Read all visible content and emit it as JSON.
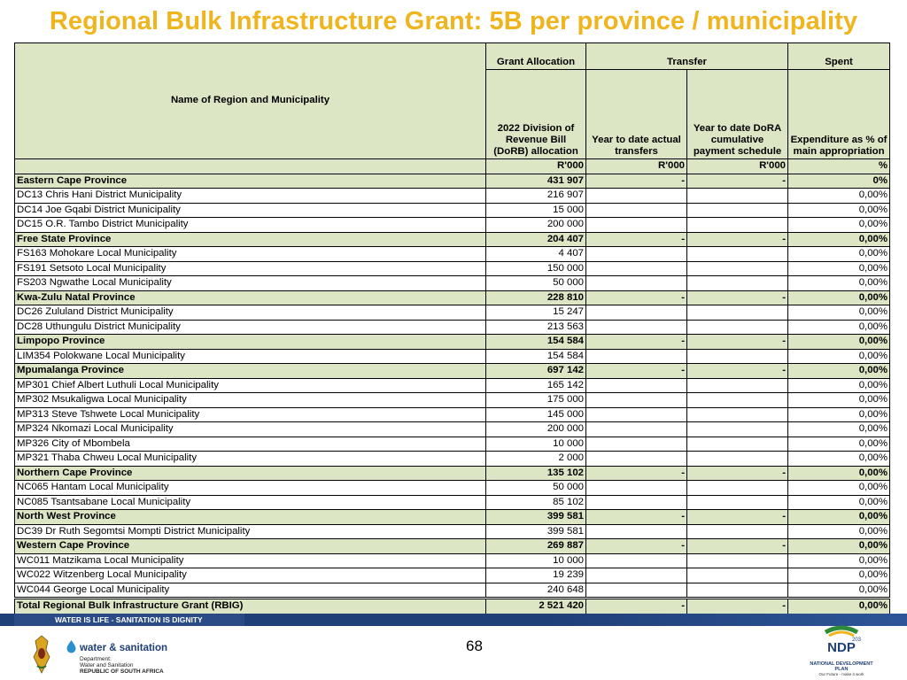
{
  "title": "Regional Bulk Infrastructure Grant: 5B per province / municipality",
  "table": {
    "name_header": "Name of Region and Municipality",
    "group_headers": {
      "grant_allocation": "Grant Allocation",
      "transfer": "Transfer",
      "spent": "Spent"
    },
    "col_headers": {
      "allocation": "2022 Division of Revenue Bill (DoRB) allocation",
      "ytd_actual": "Year to date actual transfers",
      "ytd_dora": "Year to date DoRA cumulative payment schedule",
      "expenditure": "Expenditure as % of main appropriation"
    },
    "units": {
      "allocation": "R'000",
      "ytd_actual": "R'000",
      "ytd_dora": "R'000",
      "expenditure": "%"
    },
    "rows": [
      {
        "type": "province",
        "name": "Eastern Cape Province",
        "allocation": "431 907",
        "ytd_actual": "-",
        "ytd_dora": "-",
        "expenditure": "0%"
      },
      {
        "type": "municipality",
        "name": "DC13 Chris Hani District Municipality",
        "allocation": "216 907",
        "ytd_actual": "",
        "ytd_dora": "",
        "expenditure": "0,00%"
      },
      {
        "type": "municipality",
        "name": "DC14 Joe Gqabi District Municipality",
        "allocation": "15 000",
        "ytd_actual": "",
        "ytd_dora": "",
        "expenditure": "0,00%"
      },
      {
        "type": "municipality",
        "name": "DC15 O.R. Tambo District Municipality",
        "allocation": "200 000",
        "ytd_actual": "",
        "ytd_dora": "",
        "expenditure": "0,00%"
      },
      {
        "type": "province",
        "name": "Free State Province",
        "allocation": "204 407",
        "ytd_actual": "-",
        "ytd_dora": "-",
        "expenditure": "0,00%"
      },
      {
        "type": "municipality",
        "name": "FS163 Mohokare Local Municipality",
        "allocation": "4 407",
        "ytd_actual": "",
        "ytd_dora": "",
        "expenditure": "0,00%"
      },
      {
        "type": "municipality",
        "name": "FS191 Setsoto Local Municipality",
        "allocation": "150 000",
        "ytd_actual": "",
        "ytd_dora": "",
        "expenditure": "0,00%"
      },
      {
        "type": "municipality",
        "name": "FS203 Ngwathe Local Municipality",
        "allocation": "50 000",
        "ytd_actual": "",
        "ytd_dora": "",
        "expenditure": "0,00%"
      },
      {
        "type": "province",
        "name": "Kwa-Zulu Natal Province",
        "allocation": "228 810",
        "ytd_actual": "-",
        "ytd_dora": "-",
        "expenditure": "0,00%"
      },
      {
        "type": "municipality",
        "name": "DC26 Zululand District Municipality",
        "allocation": "15 247",
        "ytd_actual": "",
        "ytd_dora": "",
        "expenditure": "0,00%"
      },
      {
        "type": "municipality",
        "name": "DC28 Uthungulu District Municipality",
        "allocation": "213 563",
        "ytd_actual": "",
        "ytd_dora": "",
        "expenditure": "0,00%"
      },
      {
        "type": "province",
        "name": "Limpopo Province",
        "allocation": "154 584",
        "ytd_actual": "-",
        "ytd_dora": "-",
        "expenditure": "0,00%"
      },
      {
        "type": "municipality",
        "name": "LIM354 Polokwane Local Municipality",
        "allocation": "154 584",
        "ytd_actual": "",
        "ytd_dora": "",
        "expenditure": "0,00%"
      },
      {
        "type": "province",
        "name": "Mpumalanga Province",
        "allocation": "697 142",
        "ytd_actual": "-",
        "ytd_dora": "-",
        "expenditure": "0,00%"
      },
      {
        "type": "municipality",
        "name": "MP301 Chief Albert Luthuli Local Municipality",
        "allocation": "165 142",
        "ytd_actual": "",
        "ytd_dora": "",
        "expenditure": "0,00%"
      },
      {
        "type": "municipality",
        "name": "MP302 Msukaligwa Local Municipality",
        "allocation": "175 000",
        "ytd_actual": "",
        "ytd_dora": "",
        "expenditure": "0,00%"
      },
      {
        "type": "municipality",
        "name": "MP313 Steve Tshwete Local Municipality",
        "allocation": "145 000",
        "ytd_actual": "",
        "ytd_dora": "",
        "expenditure": "0,00%"
      },
      {
        "type": "municipality",
        "name": "MP324 Nkomazi Local Municipality",
        "allocation": "200 000",
        "ytd_actual": "",
        "ytd_dora": "",
        "expenditure": "0,00%"
      },
      {
        "type": "municipality",
        "name": "MP326 City of Mbombela",
        "allocation": "10 000",
        "ytd_actual": "",
        "ytd_dora": "",
        "expenditure": "0,00%"
      },
      {
        "type": "municipality",
        "name": "MP321 Thaba Chweu Local Municipality",
        "allocation": "2 000",
        "ytd_actual": "",
        "ytd_dora": "",
        "expenditure": "0,00%"
      },
      {
        "type": "province",
        "name": "Northern Cape Province",
        "allocation": "135 102",
        "ytd_actual": "-",
        "ytd_dora": "-",
        "expenditure": "0,00%"
      },
      {
        "type": "municipality",
        "name": "NC065 Hantam Local Municipality",
        "allocation": "50 000",
        "ytd_actual": "",
        "ytd_dora": "",
        "expenditure": "0,00%"
      },
      {
        "type": "municipality",
        "name": "NC085 Tsantsabane Local Municipality",
        "allocation": "85 102",
        "ytd_actual": "",
        "ytd_dora": "",
        "expenditure": "0,00%"
      },
      {
        "type": "province",
        "name": "North West Province",
        "allocation": "399 581",
        "ytd_actual": "-",
        "ytd_dora": "-",
        "expenditure": "0,00%"
      },
      {
        "type": "municipality",
        "name": "DC39 Dr Ruth Segomtsi Mompti District Municipality",
        "allocation": "399 581",
        "ytd_actual": "",
        "ytd_dora": "",
        "expenditure": "0,00%"
      },
      {
        "type": "province",
        "name": "Western Cape Province",
        "allocation": "269 887",
        "ytd_actual": "-",
        "ytd_dora": "-",
        "expenditure": "0,00%"
      },
      {
        "type": "municipality",
        "name": "WC011 Matzikama Local Municipality",
        "allocation": "10 000",
        "ytd_actual": "",
        "ytd_dora": "",
        "expenditure": "0,00%"
      },
      {
        "type": "municipality",
        "name": "WC022 Witzenberg Local Municipality",
        "allocation": "19 239",
        "ytd_actual": "",
        "ytd_dora": "",
        "expenditure": "0,00%"
      },
      {
        "type": "municipality",
        "name": "WC044 George Local Municipality",
        "allocation": "240 648",
        "ytd_actual": "",
        "ytd_dora": "",
        "expenditure": "0,00%"
      },
      {
        "type": "total",
        "name": "Total Regional Bulk Infrastructure Grant (RBIG)",
        "allocation": "2 521 420",
        "ytd_actual": "-",
        "ytd_dora": "-",
        "expenditure": "0,00%"
      }
    ]
  },
  "footer": {
    "banner": "WATER IS LIFE - SANITATION IS DIGNITY",
    "page_number": "68",
    "brand": "water & sanitation",
    "dept_line1": "Department:",
    "dept_line2": "Water and Sanitation",
    "dept_line3": "REPUBLIC OF SOUTH AFRICA",
    "ndp_label": "NATIONAL DEVELOPMENT PLAN",
    "ndp_tagline": "Our Future - make it work",
    "ndp_year": "2030"
  },
  "colors": {
    "title": "#f0b51e",
    "header_fill": "#dde6c4",
    "banner": "#1f3f78"
  },
  "icons": [
    "coat-of-arms-icon",
    "water-drop-icon",
    "ndp-2030-logo-icon"
  ]
}
